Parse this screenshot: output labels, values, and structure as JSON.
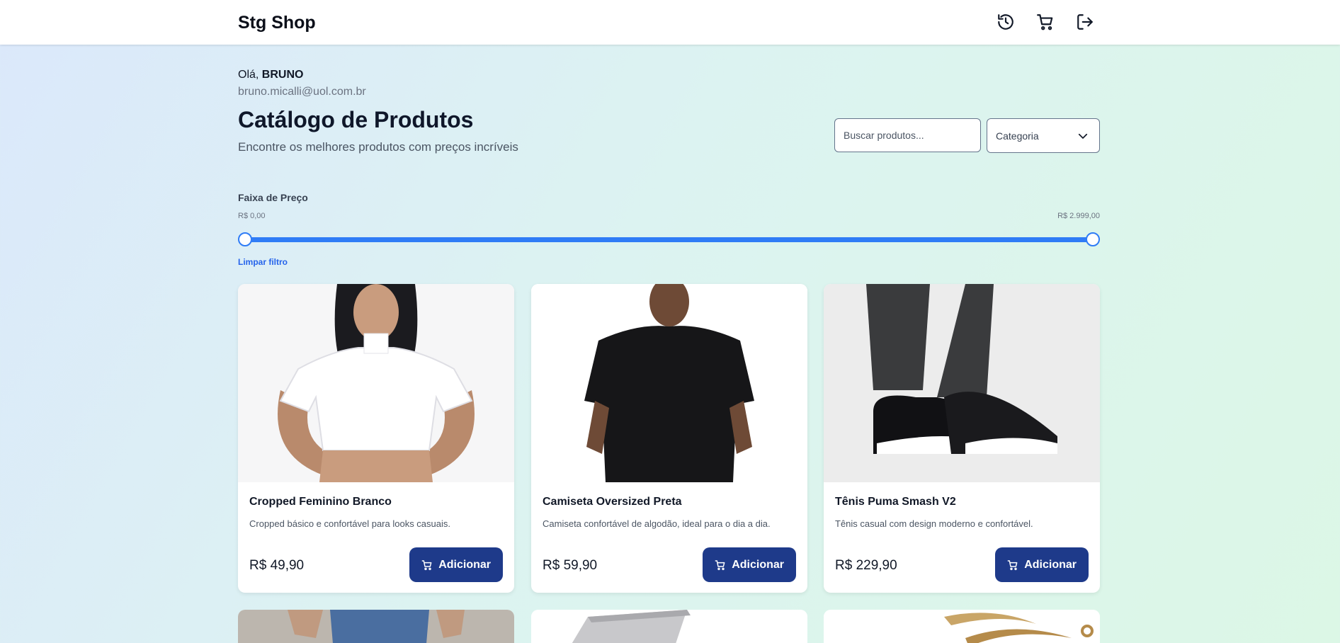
{
  "header": {
    "brand": "Stg Shop",
    "icons": [
      "history-icon",
      "cart-icon",
      "logout-icon"
    ]
  },
  "user": {
    "greeting_prefix": "Olá,",
    "name": "BRUNO",
    "email": "bruno.micalli@uol.com.br"
  },
  "catalog": {
    "title": "Catálogo de Produtos",
    "subtitle": "Encontre os melhores produtos com preços incríveis"
  },
  "filters": {
    "search_placeholder": "Buscar produtos...",
    "category_label": "Categoria",
    "price_range_label": "Faixa de Preço",
    "price_min": "R$ 0,00",
    "price_max": "R$ 2.999,00",
    "range_fraction": [
      0,
      1
    ],
    "clear_label": "Limpar filtro"
  },
  "products": [
    {
      "name": "Cropped Feminino Branco",
      "description": "Cropped básico e confortável para looks casuais.",
      "price": "R$ 49,90",
      "button": "Adicionar"
    },
    {
      "name": "Camiseta Oversized Preta",
      "description": "Camiseta confortável de algodão, ideal para o dia a dia.",
      "price": "R$ 59,90",
      "button": "Adicionar"
    },
    {
      "name": "Tênis Puma Smash V2",
      "description": "Tênis casual com design moderno e confortável.",
      "price": "R$ 229,90",
      "button": "Adicionar"
    }
  ],
  "colors": {
    "accent": "#2f7cf6",
    "button": "#1e3a8a",
    "link": "#2563eb"
  }
}
